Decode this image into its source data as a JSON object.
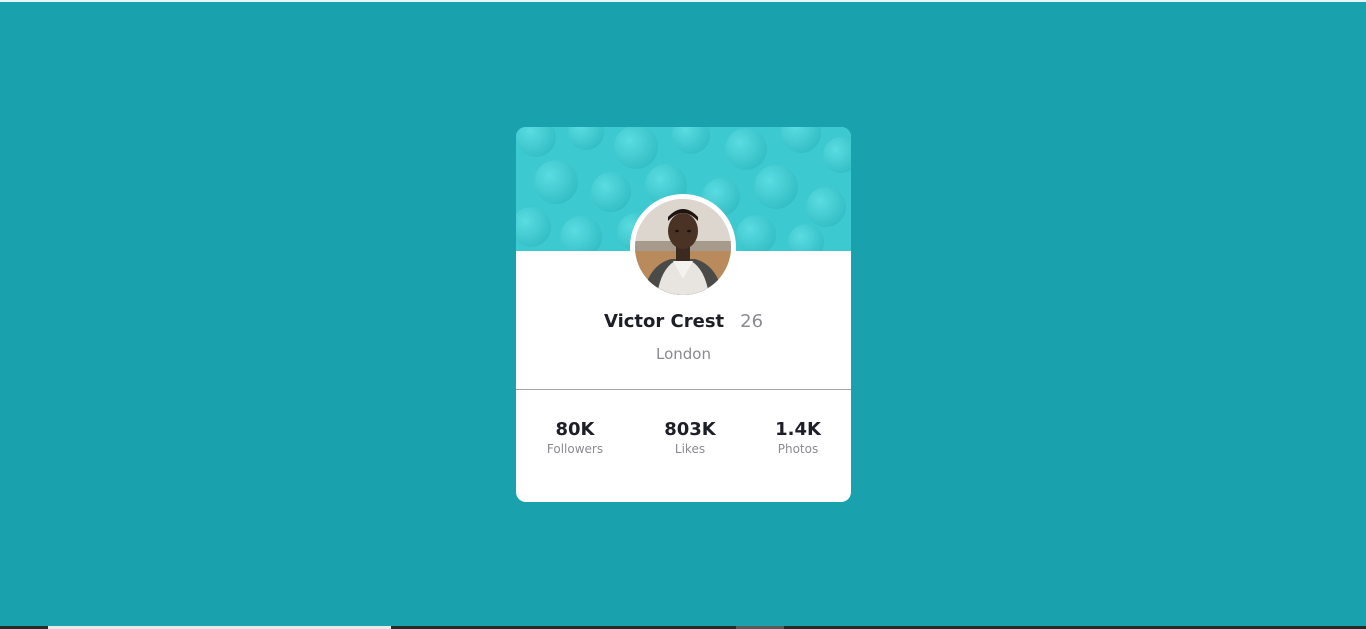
{
  "profile": {
    "name": "Victor Crest",
    "age": "26",
    "location": "London"
  },
  "stats": [
    {
      "value": "80K",
      "label": "Followers"
    },
    {
      "value": "803K",
      "label": "Likes"
    },
    {
      "value": "1.4K",
      "label": "Photos"
    }
  ],
  "colors": {
    "background": "#19a2ae",
    "header": "#3cc9d0",
    "card": "#ffffff",
    "text_dark": "#1e1f26",
    "text_muted": "#8a8b8f"
  },
  "icons": {
    "avatar": "user-photo"
  }
}
